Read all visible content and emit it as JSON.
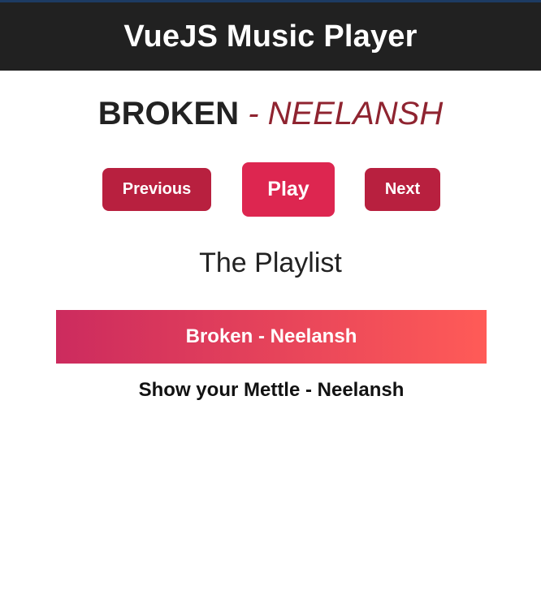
{
  "header": {
    "title": "VueJS Music Player"
  },
  "now_playing": {
    "title": "BROKEN",
    "separator_artist": " - NEELANSH"
  },
  "controls": {
    "previous_label": "Previous",
    "play_label": "Play",
    "next_label": "Next"
  },
  "playlist": {
    "heading": "The Playlist",
    "tracks": [
      {
        "label": "Broken - Neelansh",
        "active": true
      },
      {
        "label": "Show your Mettle - Neelansh",
        "active": false
      }
    ]
  },
  "colors": {
    "header_bg": "#212121",
    "accent_dark": "#b8203f",
    "accent": "#dd2650",
    "artist_text": "#8f2430",
    "gradient_start": "#cc2b5e",
    "gradient_end": "#ff5b57"
  }
}
